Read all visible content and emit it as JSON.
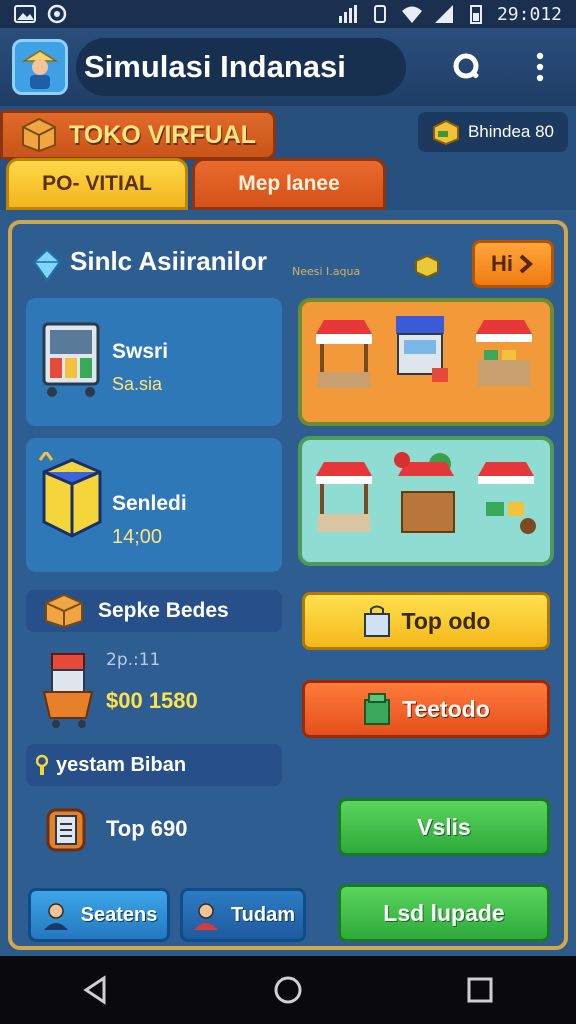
{
  "status_bar": {
    "time": "29:012"
  },
  "app_bar": {
    "title": "Simulasi Indanasi",
    "search_icon": "search-icon",
    "menu_icon": "more-vert-icon"
  },
  "store": {
    "banner": "TOKO VIRFUAL",
    "balance": "Bhindea 80",
    "tabs": [
      {
        "label": "PO- VITIAL"
      },
      {
        "label": "Mep lanee"
      }
    ]
  },
  "panel": {
    "title": "Sinlc Asiiranilor",
    "subtitle": "Neesi I.aqua",
    "hi_button": "Hi"
  },
  "cards": [
    {
      "name": "Swsri",
      "value": "Sa.sia"
    },
    {
      "name": "Senledi",
      "value": "14;00"
    }
  ],
  "rows": [
    {
      "label": "Sepke Bedes"
    },
    {
      "sub": "2p.:11",
      "amount": "$00 1580"
    },
    {
      "label": "yestam Biban"
    },
    {
      "label": "Top 690"
    }
  ],
  "buttons": {
    "top": "Top odo",
    "tootodo": "Teetodo",
    "vshis": "Vslis",
    "upgrade": "Lsd lupade",
    "seatens": "Seatens",
    "tudam": "Tudam"
  },
  "colors": {
    "panel_border": "#d3a54d",
    "accent_orange": "#f07c12",
    "accent_green": "#2eaa3c",
    "accent_yellow": "#f4b81b"
  }
}
